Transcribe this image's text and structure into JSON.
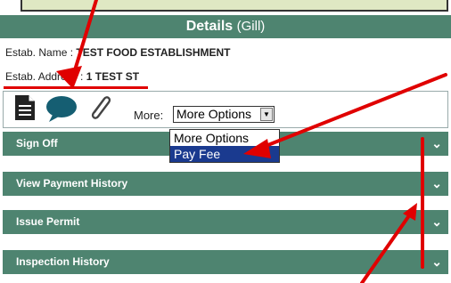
{
  "header": {
    "title": "Details",
    "subtitle": "(Gill)"
  },
  "establishment": {
    "name_label": "Estab. Name :",
    "name_value": "TEST FOOD ESTABLISHMENT",
    "address_label": "Estab. Address :",
    "address_value": "1 TEST ST"
  },
  "toolbar": {
    "icons": [
      "document-icon",
      "comment-icon",
      "paperclip-icon"
    ],
    "more_label": "More:",
    "more_select_value": "More Options"
  },
  "dropdown": {
    "options": [
      "More Options",
      "Pay Fee"
    ],
    "highlighted": "Pay Fee"
  },
  "sections": [
    {
      "label": "Sign Off"
    },
    {
      "label": "View Payment History"
    },
    {
      "label": "Issue Permit"
    },
    {
      "label": "Inspection History"
    }
  ],
  "colors": {
    "header_bg": "#4e8470",
    "dropdown_highlight": "#1a3a8f",
    "annotation_red": "#e00000"
  }
}
